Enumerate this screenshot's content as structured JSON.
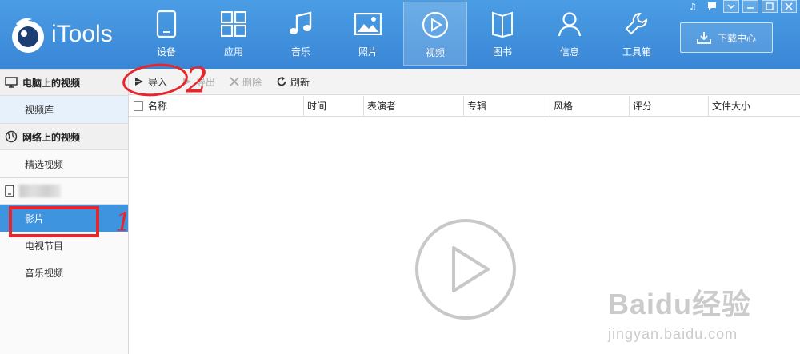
{
  "app": {
    "logo_text": "iTools"
  },
  "nav": {
    "items": [
      {
        "label": "设备",
        "icon": "phone-icon"
      },
      {
        "label": "应用",
        "icon": "apps-grid-icon"
      },
      {
        "label": "音乐",
        "icon": "music-note-icon"
      },
      {
        "label": "照片",
        "icon": "photo-icon"
      },
      {
        "label": "视频",
        "icon": "play-circle-icon",
        "active": true
      },
      {
        "label": "图书",
        "icon": "book-icon"
      },
      {
        "label": "信息",
        "icon": "user-icon"
      },
      {
        "label": "工具箱",
        "icon": "wrench-icon"
      }
    ]
  },
  "download": {
    "label": "下载中心"
  },
  "sidebar": {
    "sections": [
      {
        "header": "电脑上的视频",
        "items": [
          "视频库"
        ]
      },
      {
        "header": "网络上的视频",
        "items": [
          "精选视频"
        ]
      },
      {
        "header": "",
        "items": [
          "影片",
          "电视节目",
          "音乐视频"
        ]
      }
    ]
  },
  "toolbar": {
    "import": "导入",
    "export": "导出",
    "delete": "删除",
    "refresh": "刷新"
  },
  "table": {
    "columns": [
      "名称",
      "时间",
      "表演者",
      "专辑",
      "风格",
      "评分",
      "文件大小"
    ]
  },
  "annotations": {
    "one": "1",
    "two": "2"
  },
  "watermark": {
    "main": "Baidu经验",
    "sub": "jingyan.baidu.com"
  },
  "colors": {
    "header_blue": "#3f8edc",
    "selected_blue": "#3f94e0",
    "annotation_red": "#e8252b"
  }
}
